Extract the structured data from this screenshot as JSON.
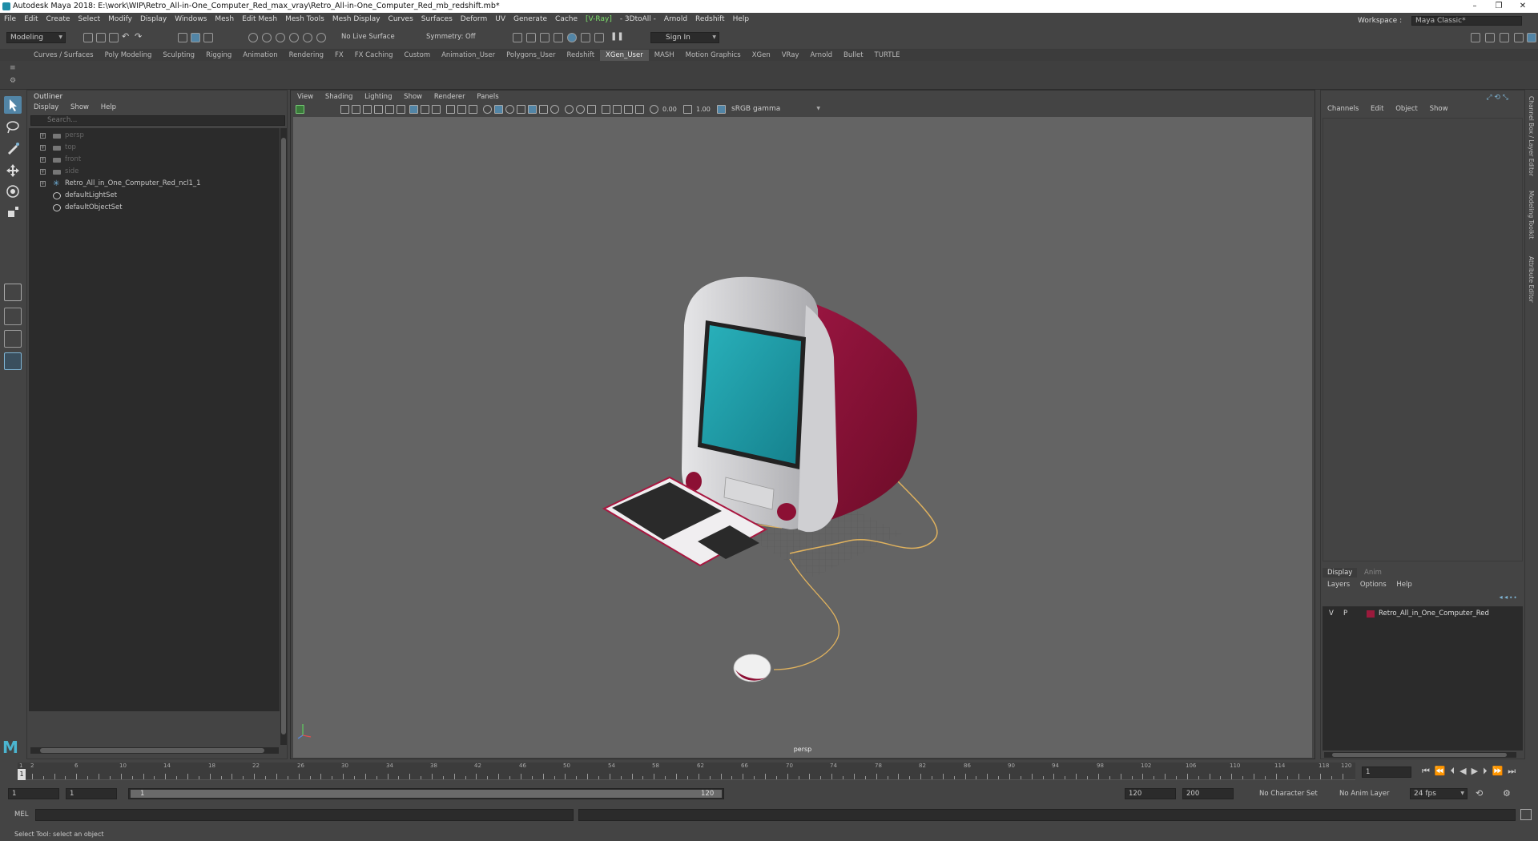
{
  "title": "Autodesk Maya 2018: E:\\work\\WIP\\Retro_All-in-One_Computer_Red_max_vray\\Retro_All-in-One_Computer_Red_mb_redshift.mb*",
  "window_controls": [
    "–",
    "❐",
    "✕"
  ],
  "menus": [
    "File",
    "Edit",
    "Create",
    "Select",
    "Modify",
    "Display",
    "Windows",
    "Mesh",
    "Edit Mesh",
    "Mesh Tools",
    "Mesh Display",
    "Curves",
    "Surfaces",
    "Deform",
    "UV",
    "Generate",
    "Cache",
    "[V-Ray]",
    "- 3DtoAll -",
    "Arnold",
    "Redshift",
    "Help"
  ],
  "workspace": {
    "label": "Workspace :",
    "value": "Maya Classic*"
  },
  "status": {
    "mode": "Modeling",
    "live_surface": "No Live Surface",
    "symmetry": "Symmetry: Off",
    "sign_in": "Sign In"
  },
  "shelf_tabs": [
    "Curves / Surfaces",
    "Poly Modeling",
    "Sculpting",
    "Rigging",
    "Animation",
    "Rendering",
    "FX",
    "FX Caching",
    "Custom",
    "Animation_User",
    "Polygons_User",
    "Redshift",
    "XGen_User",
    "MASH",
    "Motion Graphics",
    "XGen",
    "VRay",
    "Arnold",
    "Bullet",
    "TURTLE"
  ],
  "active_shelf_tab": "XGen_User",
  "outliner": {
    "title": "Outliner",
    "menu": [
      "Display",
      "Show",
      "Help"
    ],
    "search_placeholder": "Search...",
    "items": [
      {
        "label": "persp",
        "dim": true,
        "icon": "camera-icon"
      },
      {
        "label": "top",
        "dim": true,
        "icon": "camera-icon"
      },
      {
        "label": "front",
        "dim": true,
        "icon": "camera-icon"
      },
      {
        "label": "side",
        "dim": true,
        "icon": "camera-icon"
      },
      {
        "label": "Retro_All_in_One_Computer_Red_ncl1_1",
        "dim": false,
        "icon": "transform-icon"
      },
      {
        "label": "defaultLightSet",
        "dim": false,
        "icon": "set-icon"
      },
      {
        "label": "defaultObjectSet",
        "dim": false,
        "icon": "set-icon"
      }
    ]
  },
  "viewport": {
    "menu": [
      "View",
      "Shading",
      "Lighting",
      "Show",
      "Renderer",
      "Panels"
    ],
    "exposure": "0.00",
    "gamma": "1.00",
    "color_space": "sRGB gamma",
    "camera_label": "persp"
  },
  "channel_box": {
    "menu": [
      "Channels",
      "Edit",
      "Object",
      "Show"
    ],
    "side_tabs": [
      "Channel Box / Layer Editor",
      "Modeling Toolkit",
      "Attribute Editor"
    ]
  },
  "layer_editor": {
    "tabs": [
      "Display",
      "Anim"
    ],
    "menu": [
      "Layers",
      "Options",
      "Help"
    ],
    "layer": {
      "v": "V",
      "p": "P",
      "name": "Retro_All_in_One_Computer_Red",
      "color": "#9b1a3c"
    }
  },
  "timeline": {
    "labels": [
      "1",
      "2",
      "6",
      "10",
      "14",
      "18",
      "22",
      "26",
      "30",
      "34",
      "38",
      "42",
      "46",
      "50",
      "54",
      "58",
      "62",
      "66",
      "70",
      "74",
      "78",
      "82",
      "86",
      "90",
      "94",
      "98",
      "102",
      "106",
      "110",
      "114",
      "118",
      "120"
    ],
    "current_frame": "1"
  },
  "range": {
    "start": "1",
    "playback_start": "1",
    "slider_start": "1",
    "slider_end": "120",
    "playback_end": "120",
    "end": "200",
    "character_set": "No Character Set",
    "anim_layer": "No Anim Layer",
    "fps": "24 fps"
  },
  "command": {
    "language": "MEL"
  },
  "help_text": "Select Tool: select an object",
  "colors": {
    "accent": "#5285a6",
    "computer_red": "#8c1034",
    "screen_teal": "#1fa0ac"
  }
}
